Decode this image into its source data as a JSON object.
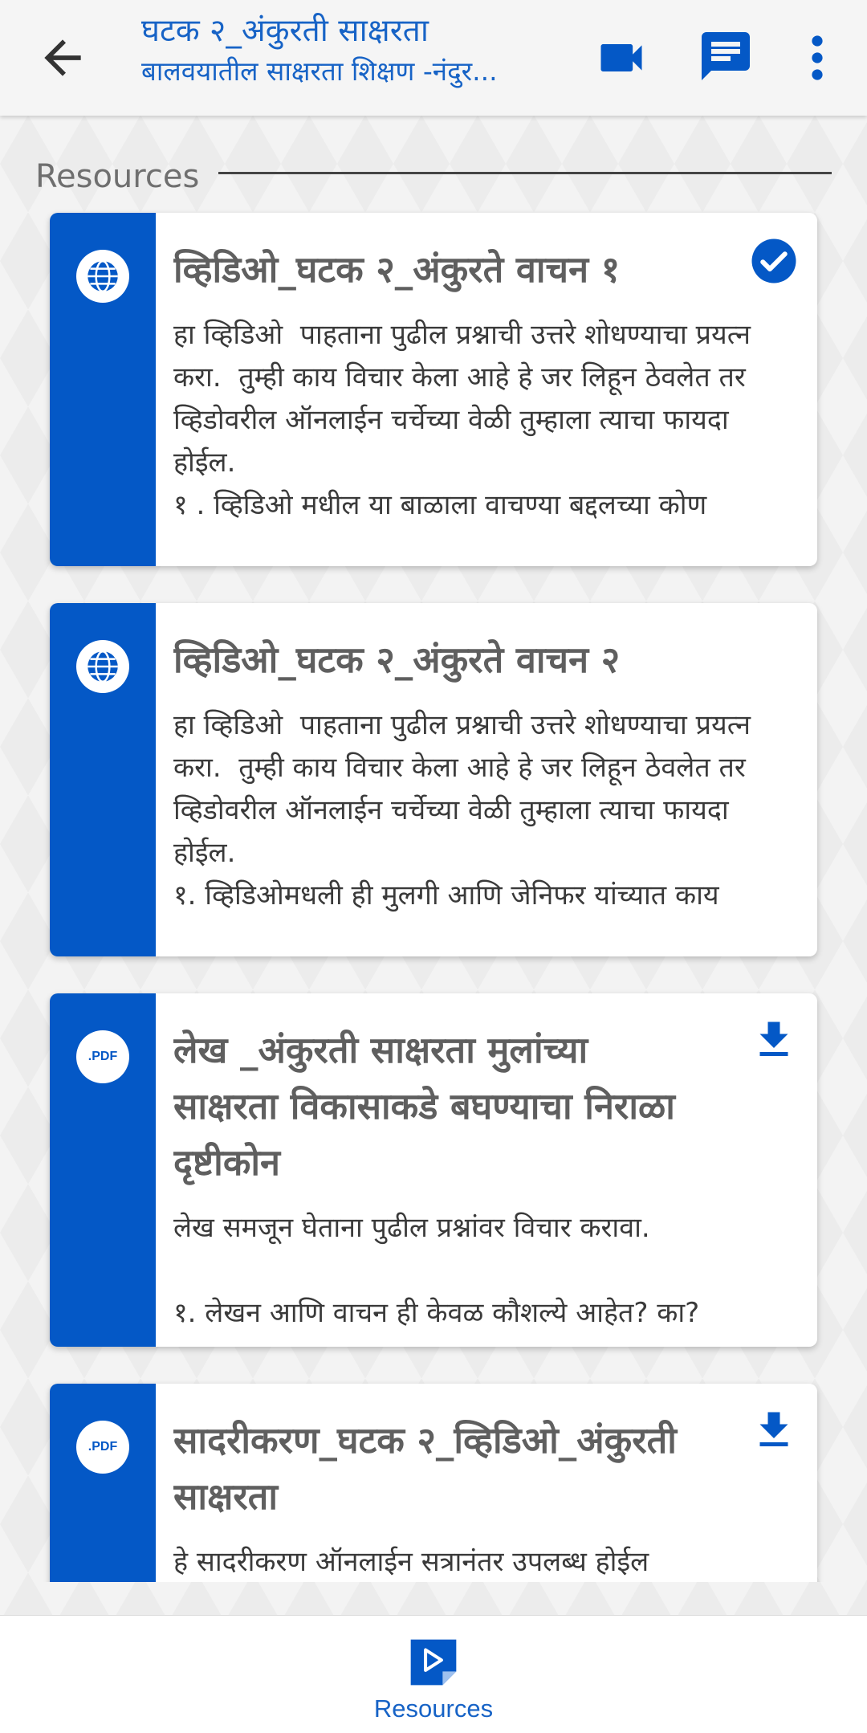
{
  "header": {
    "title": "घटक २_अंकुरती साक्षरता",
    "subtitle": "बालवयातील साक्षरता शिक्षण -नंदुर..."
  },
  "section": {
    "title": "Resources"
  },
  "cards": [
    {
      "type": "web",
      "title": "व्हिडिओ_घटक २_अंकुरते वाचन १",
      "status": "completed",
      "description": "हा व्हिडिओ  पाहताना पुढील प्रश्नाची उत्तरे शोधण्याचा प्रयत्न करा.  तुम्ही काय विचार केला आहे हे जर लिहून ठेवलेत तर व्हिडोवरील ऑनलाईन चर्चेच्या वेळी तुम्हाला त्याचा फायदा होईल.\n१ . व्हिडिओ मधील या बाळाला वाचण्या बद्दलच्या कोण"
    },
    {
      "type": "web",
      "title": "व्हिडिओ_घटक २_अंकुरते वाचन २",
      "status": "",
      "description": "हा व्हिडिओ  पाहताना पुढील प्रश्नाची उत्तरे शोधण्याचा प्रयत्न करा.  तुम्ही काय विचार केला आहे हे जर लिहून ठेवलेत तर व्हिडोवरील ऑनलाईन चर्चेच्या वेळी तुम्हाला त्याचा फायदा होईल.\n१. व्हिडिओमधली ही मुलगी आणि जेनिफर यांच्यात काय"
    },
    {
      "type": "pdf",
      "type_label": ".PDF",
      "title": "लेख _अंकुरती साक्षरता मुलांच्या साक्षरता  विकासाकडे बघण्याचा निराळा दृष्टीकोन",
      "status": "download",
      "description": "लेख समजून घेताना पुढील प्रश्नांवर विचार करावा.\n\n१. लेखन आणि वाचन ही केवळ कौशल्ये आहेत? का?"
    },
    {
      "type": "pdf",
      "type_label": ".PDF",
      "title": "सादरीकरण_घटक २_व्हिडिओ_अंकुरती साक्षरता",
      "status": "download",
      "description": "हे सादरीकरण ऑनलाईन सत्रानंतर उपलब्ध होईल"
    }
  ],
  "bottom_nav": {
    "resources_label": "Resources"
  },
  "colors": {
    "primary": "#0458c6",
    "title_blue": "#1763c6",
    "card_title": "#5f5f5f"
  }
}
